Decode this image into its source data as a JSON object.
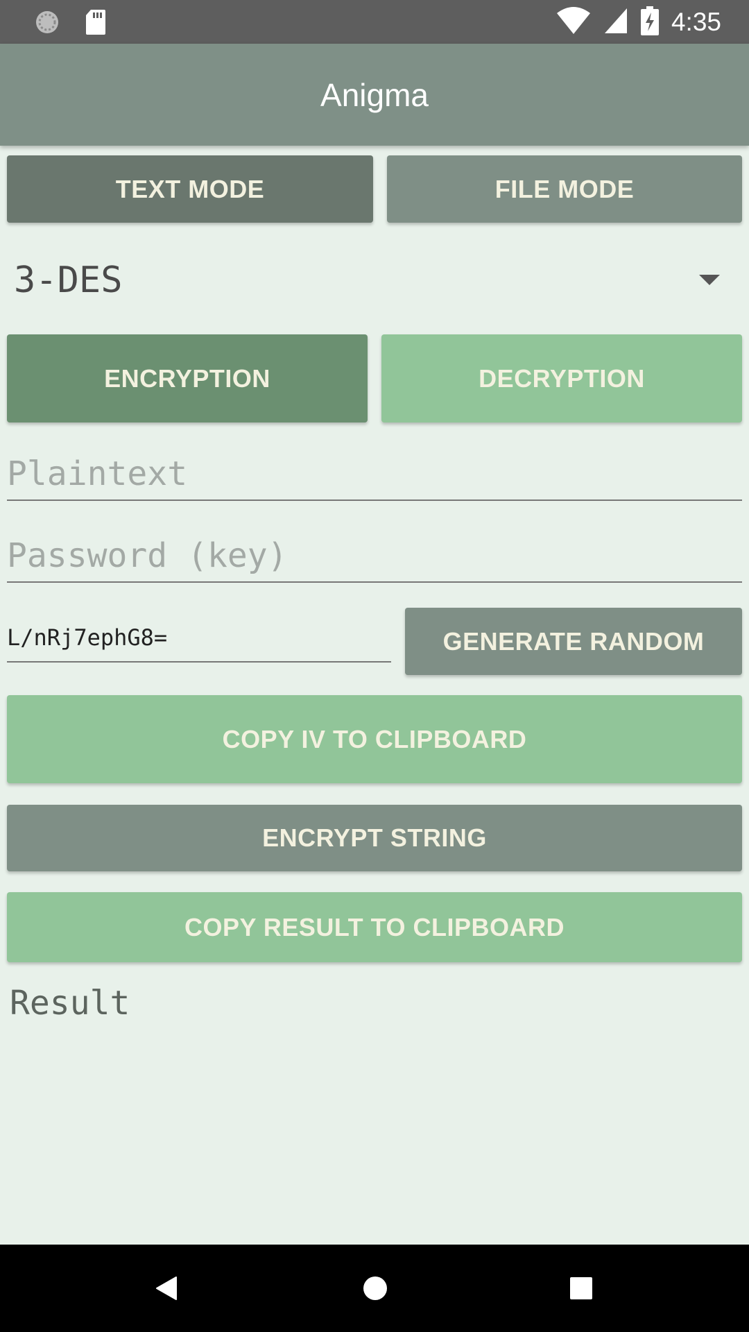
{
  "status_bar": {
    "time": "4:35",
    "icons": [
      "sync-icon",
      "sd-card-icon",
      "wifi-icon",
      "signal-icon",
      "battery-charging-icon"
    ]
  },
  "app_bar": {
    "title": "Anigma"
  },
  "mode_tabs": {
    "text_mode": "TEXT MODE",
    "file_mode": "FILE MODE"
  },
  "algorithm": {
    "selected": "3-DES"
  },
  "operation": {
    "encryption": "ENCRYPTION",
    "decryption": "DECRYPTION"
  },
  "inputs": {
    "plaintext_placeholder": "Plaintext",
    "plaintext_value": "",
    "password_placeholder": "Password (key)",
    "password_value": "",
    "iv_value": "L/nRj7ephG8="
  },
  "buttons": {
    "generate_random": "GENERATE RANDOM",
    "copy_iv": "COPY IV TO CLIPBOARD",
    "encrypt_string": "ENCRYPT STRING",
    "copy_result": "COPY RESULT TO CLIPBOARD"
  },
  "result": {
    "label": "Result"
  },
  "nav_bar": {
    "icons": [
      "back-icon",
      "home-icon",
      "recents-icon"
    ]
  },
  "colors": {
    "background": "#E8F1EA",
    "status_bar": "#5E5E5E",
    "app_bar": "#7F9087",
    "button_dark_grey": "#6A776E",
    "button_grey": "#7F8F86",
    "button_dark_green": "#6B9071",
    "button_light_green": "#91C599",
    "button_text": "#F3F1DF"
  }
}
